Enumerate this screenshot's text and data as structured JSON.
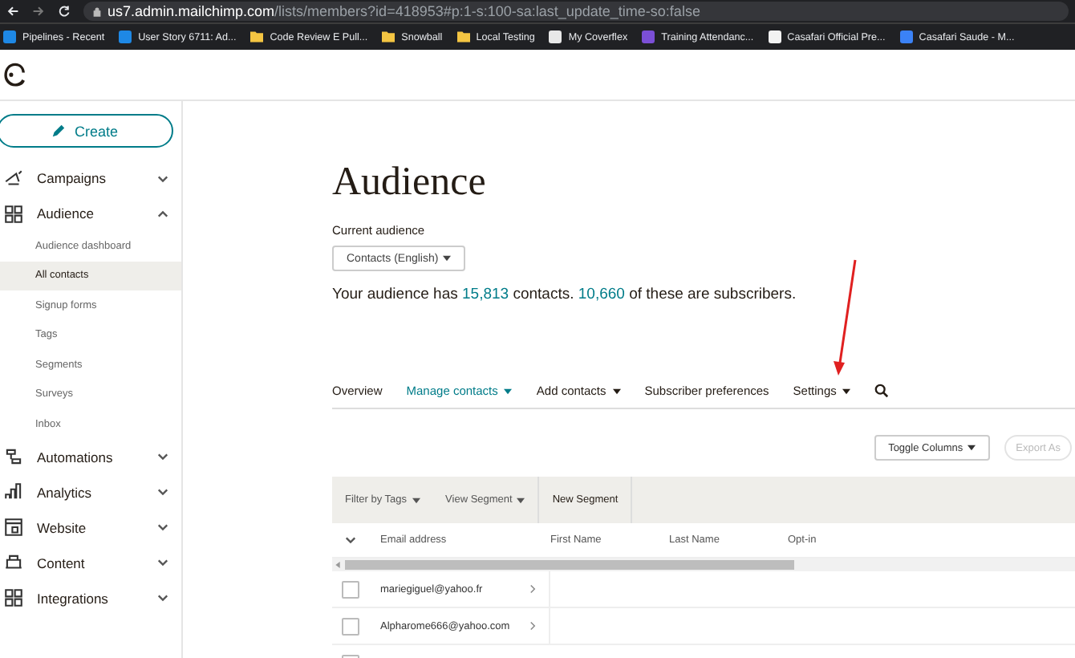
{
  "browser": {
    "url_host": "us7.admin.mailchimp.com",
    "url_path": "/lists/members?id=418953#p:1-s:100-sa:last_update_time-so:false",
    "bookmarks": [
      {
        "label": "Pipelines - Recent",
        "kind": "site",
        "color": "#1e88e5"
      },
      {
        "label": "User Story 6711: Ad...",
        "kind": "site",
        "color": "#1e88e5"
      },
      {
        "label": "Code Review E Pull...",
        "kind": "folder"
      },
      {
        "label": "Snowball",
        "kind": "folder"
      },
      {
        "label": "Local Testing",
        "kind": "folder"
      },
      {
        "label": "My Coverflex",
        "kind": "site",
        "color": "#e8e8e8"
      },
      {
        "label": "Training Attendanc...",
        "kind": "site",
        "color": "#7b4fd6"
      },
      {
        "label": "Casafari Official Pre...",
        "kind": "site",
        "color": "#f2f2f2"
      },
      {
        "label": "Casafari Saude - M...",
        "kind": "site",
        "color": "#3b82f6"
      }
    ]
  },
  "sidebar": {
    "create_label": "Create",
    "items": [
      {
        "label": "Campaigns",
        "expanded": false
      },
      {
        "label": "Audience",
        "expanded": true,
        "children": [
          {
            "label": "Audience dashboard",
            "selected": false
          },
          {
            "label": "All contacts",
            "selected": true
          },
          {
            "label": "Signup forms",
            "selected": false
          },
          {
            "label": "Tags",
            "selected": false
          },
          {
            "label": "Segments",
            "selected": false
          },
          {
            "label": "Surveys",
            "selected": false
          },
          {
            "label": "Inbox",
            "selected": false
          }
        ]
      },
      {
        "label": "Automations",
        "expanded": false
      },
      {
        "label": "Analytics",
        "expanded": false
      },
      {
        "label": "Website",
        "expanded": false
      },
      {
        "label": "Content",
        "expanded": false
      },
      {
        "label": "Integrations",
        "expanded": false
      }
    ]
  },
  "page": {
    "title": "Audience",
    "current_audience_label": "Current audience",
    "audience_select": "Contacts (English)",
    "summary": {
      "before": "Your audience has",
      "contacts": "15,813",
      "middle": "contacts.",
      "subscribers": "10,660",
      "after": "of these are subscribers."
    },
    "tabs": [
      {
        "label": "Overview",
        "selected": false,
        "dropdown": false
      },
      {
        "label": "Manage contacts",
        "selected": true,
        "dropdown": true
      },
      {
        "label": "Add contacts",
        "selected": false,
        "dropdown": true
      },
      {
        "label": "Subscriber preferences",
        "selected": false,
        "dropdown": false
      },
      {
        "label": "Settings",
        "selected": false,
        "dropdown": true
      }
    ],
    "toggle_columns": "Toggle Columns",
    "export": "Export As",
    "filters": [
      {
        "label": "Filter by Tags",
        "dropdown": true
      },
      {
        "label": "View Segment",
        "dropdown": true
      },
      {
        "label": "New Segment",
        "dropdown": false
      }
    ],
    "table": {
      "columns": [
        "Email address",
        "First Name",
        "Last Name",
        "Opt-in"
      ],
      "rows": [
        {
          "email": "mariegiguel@yahoo.fr",
          "checked": false
        },
        {
          "email": "Alpharome666@yahoo.com",
          "checked": false
        },
        {
          "email": "",
          "checked": false
        }
      ]
    }
  }
}
